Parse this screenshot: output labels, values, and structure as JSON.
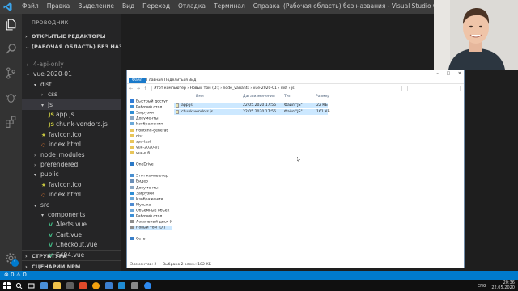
{
  "vscode": {
    "menu": [
      "Файл",
      "Правка",
      "Выделение",
      "Вид",
      "Переход",
      "Отладка",
      "Терминал",
      "Справка"
    ],
    "window_title": "(Рабочая область) без названия - Visual Studio Code",
    "sidebar": {
      "title": "ПРОВОДНИК",
      "open_editors": "ОТКРЫТЫЕ РЕДАКТОРЫ",
      "workspace": "(РАБОЧАЯ ОБЛАСТЬ) БЕЗ НАЗВА...",
      "tree": [
        {
          "label": "4-api-only",
          "type": "folder",
          "state": "closed",
          "depth": 0,
          "faded": true
        },
        {
          "label": "vue-2020-01",
          "type": "folder",
          "state": "open",
          "depth": 0
        },
        {
          "label": "dist",
          "type": "folder",
          "state": "open",
          "depth": 1
        },
        {
          "label": "css",
          "type": "folder",
          "state": "closed",
          "depth": 2
        },
        {
          "label": "js",
          "type": "folder",
          "state": "open",
          "depth": 2,
          "selected": true
        },
        {
          "label": "app.js",
          "type": "js",
          "depth": 3
        },
        {
          "label": "chunk-vendors.js",
          "type": "js",
          "depth": 3
        },
        {
          "label": "favicon.ico",
          "type": "ico",
          "depth": 2
        },
        {
          "label": "index.html",
          "type": "html",
          "depth": 2
        },
        {
          "label": "node_modules",
          "type": "folder",
          "state": "closed",
          "depth": 1
        },
        {
          "label": "prerendered",
          "type": "folder",
          "state": "closed",
          "depth": 1
        },
        {
          "label": "public",
          "type": "folder",
          "state": "open",
          "depth": 1
        },
        {
          "label": "favicon.ico",
          "type": "ico",
          "depth": 2
        },
        {
          "label": "index.html",
          "type": "html",
          "depth": 2
        },
        {
          "label": "src",
          "type": "folder",
          "state": "open",
          "depth": 1
        },
        {
          "label": "components",
          "type": "folder",
          "state": "open",
          "depth": 2
        },
        {
          "label": "Alerts.vue",
          "type": "vue",
          "depth": 3
        },
        {
          "label": "Cart.vue",
          "type": "vue",
          "depth": 3
        },
        {
          "label": "Checkout.vue",
          "type": "vue",
          "depth": 3
        },
        {
          "label": "E404.vue",
          "type": "vue",
          "depth": 3
        }
      ],
      "outline": "СТРУКТУРА",
      "npm_scripts": "СЦЕНАРИИ NPM"
    },
    "activity_badge": "1",
    "status": {
      "errors": "0",
      "warnings": "0"
    }
  },
  "explorer": {
    "ribbon_tabs": [
      "Файл",
      "Главная",
      "Поделиться",
      "Вид"
    ],
    "window_controls": [
      "–",
      "□",
      "✕"
    ],
    "path": "Этот компьютер  ›  Новый том (D:)  ›  node_variants  ›  vue-2020-01  ›  dist  ›  js",
    "nav": [
      {
        "label": "Быстрый доступ",
        "icon": "star"
      },
      {
        "label": "Рабочий стол",
        "icon": "desktop"
      },
      {
        "label": "Загрузки",
        "icon": "download"
      },
      {
        "label": "Документы",
        "icon": "doc"
      },
      {
        "label": "Изображения",
        "icon": "pic"
      },
      {
        "label": "frontend-generat",
        "icon": "folder"
      },
      {
        "label": "dist",
        "icon": "folder"
      },
      {
        "label": "spa-test",
        "icon": "folder"
      },
      {
        "label": "vue-2020-01",
        "icon": "folder"
      },
      {
        "label": "vue-в 6",
        "icon": "folder"
      },
      {
        "label": "",
        "icon": "none"
      },
      {
        "label": "OneDrive",
        "icon": "cloud"
      },
      {
        "label": "",
        "icon": "none"
      },
      {
        "label": "Этот компьютер",
        "icon": "pc"
      },
      {
        "label": "Видео",
        "icon": "video"
      },
      {
        "label": "Документы",
        "icon": "doc"
      },
      {
        "label": "Загрузки",
        "icon": "download"
      },
      {
        "label": "Изображения",
        "icon": "pic"
      },
      {
        "label": "Музыка",
        "icon": "music"
      },
      {
        "label": "Объемные объек",
        "icon": "cube"
      },
      {
        "label": "Рабочий стол",
        "icon": "desktop"
      },
      {
        "label": "Локальный диск (C",
        "icon": "drive"
      },
      {
        "label": "Новый том (D:)",
        "icon": "drive",
        "selected": true
      },
      {
        "label": "",
        "icon": "none"
      },
      {
        "label": "Сеть",
        "icon": "net"
      }
    ],
    "columns": [
      "Имя",
      "Дата изменения",
      "Тип",
      "Размер"
    ],
    "files": [
      {
        "name": "app.js",
        "date": "22.05.2020 17:56",
        "type": "Файл \"JS\"",
        "size": "22 КБ"
      },
      {
        "name": "chunk-vendors.js",
        "date": "22.05.2020 17:56",
        "type": "Файл \"JS\"",
        "size": "161 КБ"
      }
    ],
    "status_items": "Элементов: 2",
    "status_selected": "Выбрано 2 элем.: 182 КБ"
  },
  "taskbar": {
    "lang": "ENG",
    "time": "20:36",
    "date": "22.05.2020"
  }
}
